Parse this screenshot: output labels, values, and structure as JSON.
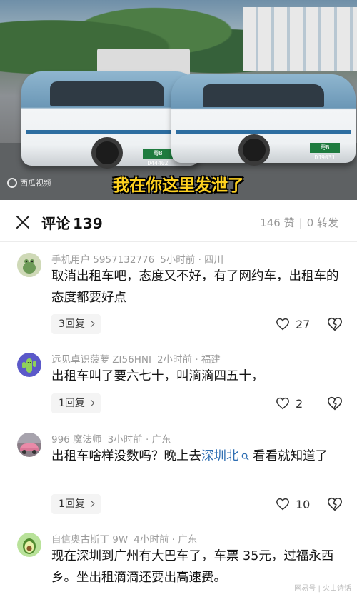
{
  "video": {
    "subtitle": "我在你这里发泄了",
    "source_watermark": "西瓜视频",
    "plates": [
      "粤B D44402",
      "粤B DJ9031"
    ]
  },
  "header": {
    "title_label": "评论",
    "comment_count": "139",
    "likes": "146 赞",
    "shares": "0 转发"
  },
  "comments": [
    {
      "user": "手机用户 5957132776",
      "time": "5小时前",
      "location": "四川",
      "text": "取消出租车吧，态度又不好，有了网约车，出租车的态度都要好点",
      "replies": "3回复",
      "likes": "27"
    },
    {
      "user": "远见卓识菠萝 ZI56HNI",
      "time": "2小时前",
      "location": "福建",
      "text": "出租车叫了要六七十，叫滴滴四五十，",
      "replies": "1回复",
      "likes": "2"
    },
    {
      "user": "996 魔法师",
      "time": "3小时前",
      "location": "广东",
      "text_before": "出租车啥样没数吗？晚上去",
      "text_link": "深圳北",
      "text_after": "看看就知道了",
      "replies": "1回复",
      "likes": "10"
    },
    {
      "user": "自信奥古斯丁 9W",
      "time": "4小时前",
      "location": "广东",
      "text": "现在深圳到广州有大巴车了，车票 35元，过福永西乡。坐出租滴滴还要出高速费。"
    }
  ],
  "footer_watermark": "网易号 | 火山诗话",
  "colors": {
    "link": "#2f6fb3",
    "subtitle": "#ffd21f",
    "meta": "#9a9a9a"
  }
}
